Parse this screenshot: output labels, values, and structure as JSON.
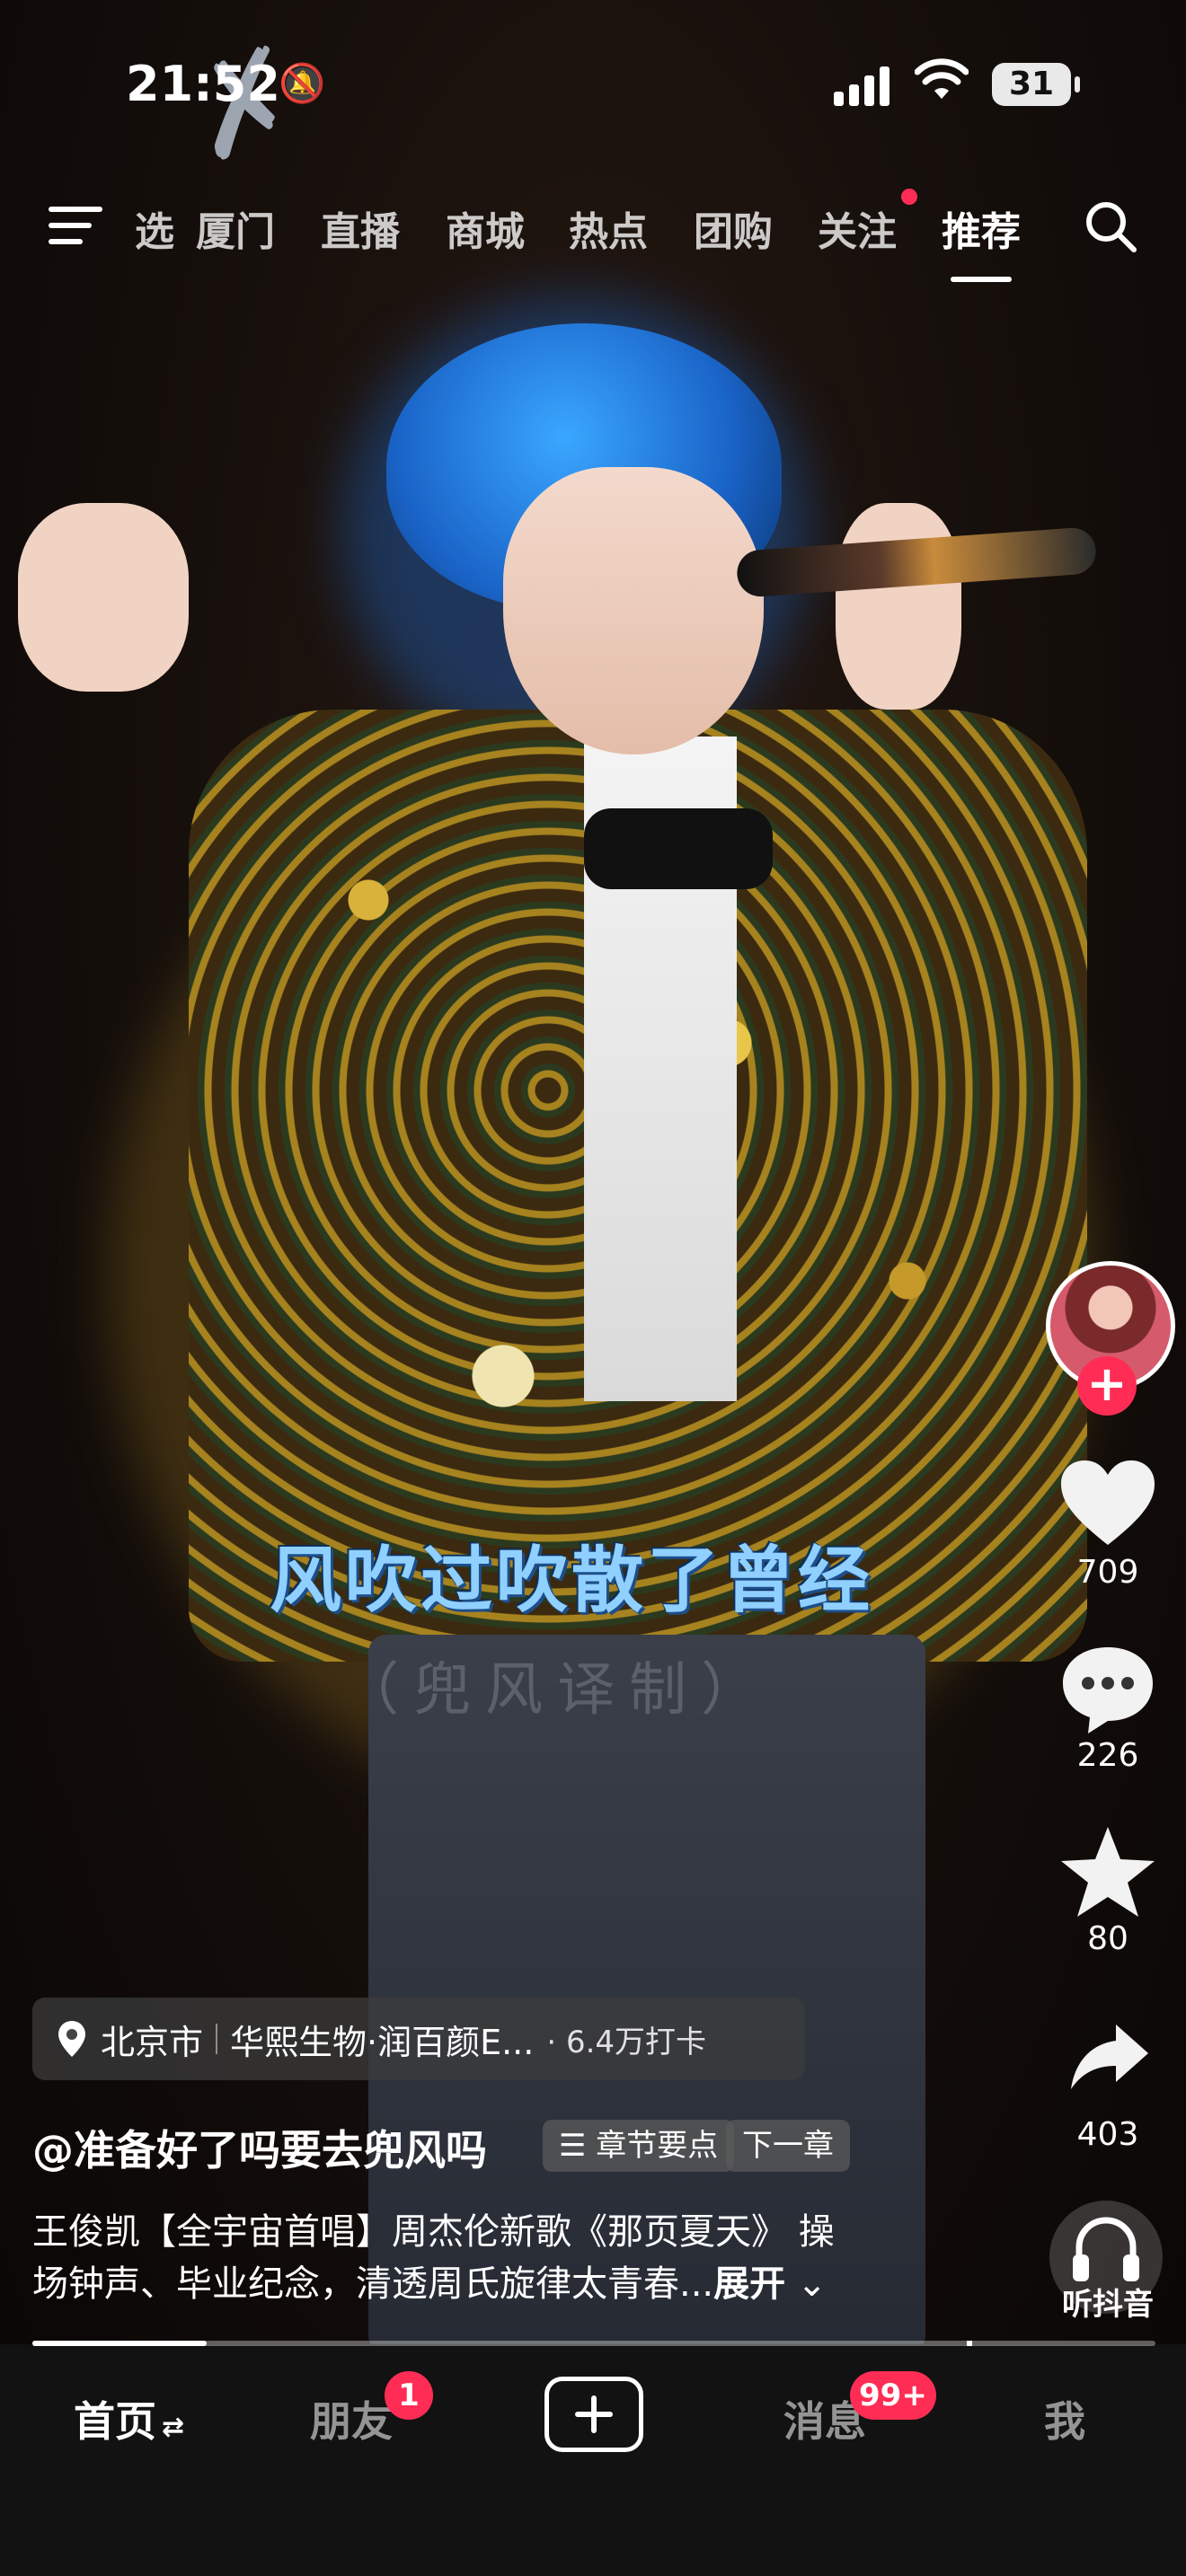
{
  "status_bar": {
    "time": "21:52",
    "battery": "31"
  },
  "top_nav": {
    "items": [
      "选",
      "厦门",
      "直播",
      "商城",
      "热点",
      "团购",
      "关注",
      "推荐"
    ],
    "active": "推荐"
  },
  "video": {
    "subtitle": "风吹过吹散了曾经",
    "watermark": "（兜风译制）"
  },
  "right_rail": {
    "likes": "709",
    "comments": "226",
    "favorites": "80",
    "shares": "403",
    "listen_label": "听抖音"
  },
  "location": {
    "city": "北京市",
    "poi": "华熙生物·润百颜E...",
    "checkins": "· 6.4万打卡"
  },
  "post": {
    "author": "@准备好了吗要去兜风吗",
    "chapters_label": "章节要点",
    "next_label": "下一章",
    "description_line1": "王俊凯【全宇宙首唱】周杰伦新歌《那页夏天》 操",
    "description_line2": "场钟声、毕业纪念，清透周氏旋律太青春...",
    "expand_label": "展开"
  },
  "playback": {
    "progress": 0.155
  },
  "tab_bar": {
    "home": "首页",
    "friends": "朋友",
    "friends_badge": "1",
    "messages": "消息",
    "messages_badge": "99+",
    "me": "我"
  },
  "colors": {
    "accent": "#ff2d55",
    "subtitle": "#8fd0ff"
  }
}
